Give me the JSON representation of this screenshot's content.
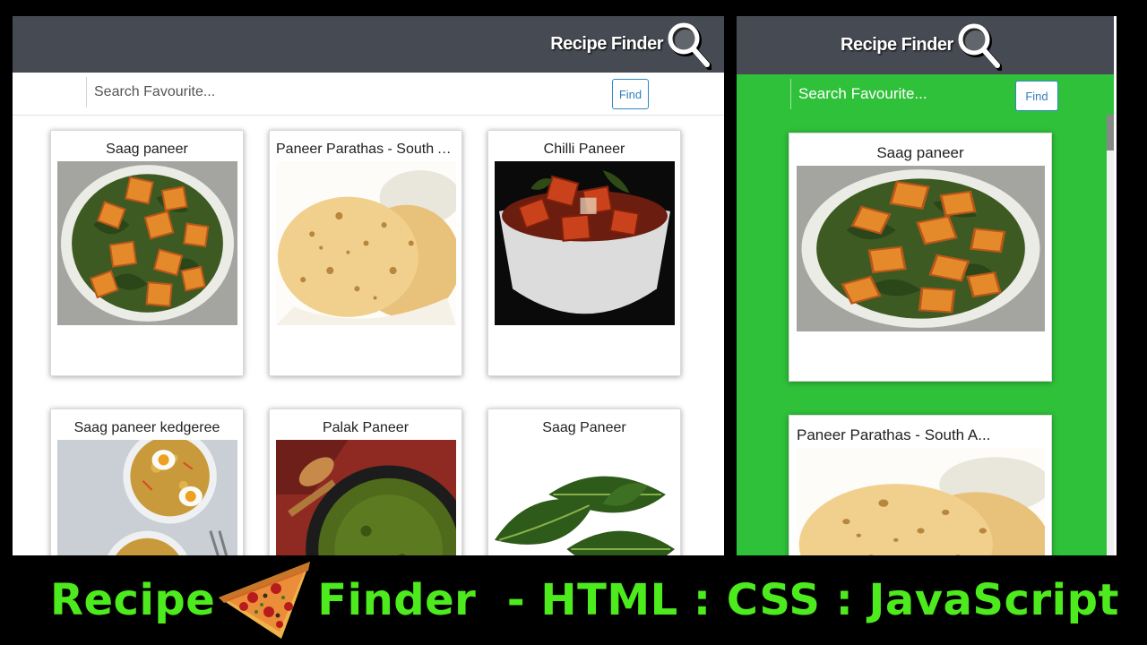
{
  "desktop": {
    "brand": "Recipe Finder",
    "search": {
      "placeholder": "Search Favourite...",
      "button": "Find"
    },
    "cards": [
      {
        "title": "Saag paneer",
        "image": "saag-paneer"
      },
      {
        "title": "Paneer Parathas - South A...",
        "image": "paratha"
      },
      {
        "title": "Chilli Paneer",
        "image": "chilli-paneer"
      },
      {
        "title": "Saag paneer kedgeree",
        "image": "kedgeree"
      },
      {
        "title": "Palak Paneer",
        "image": "palak-paneer"
      },
      {
        "title": "Saag Paneer",
        "image": "spinach"
      }
    ]
  },
  "mobile": {
    "brand": "Recipe Finder",
    "search": {
      "placeholder": "Search Favourite...",
      "button": "Find"
    },
    "cards": [
      {
        "title": "Saag paneer",
        "image": "saag-paneer"
      },
      {
        "title": "Paneer Parathas - South A...",
        "image": "paratha"
      }
    ]
  },
  "caption": {
    "part1": "Recipe",
    "part2": "Finder  - HTML : CSS : JavaScript",
    "icon": "pizza-slice-icon"
  },
  "colors": {
    "header": "#464a53",
    "mobile_background": "#2fc13a",
    "caption": "#4dea1e",
    "find_button": "#2e88c6"
  }
}
